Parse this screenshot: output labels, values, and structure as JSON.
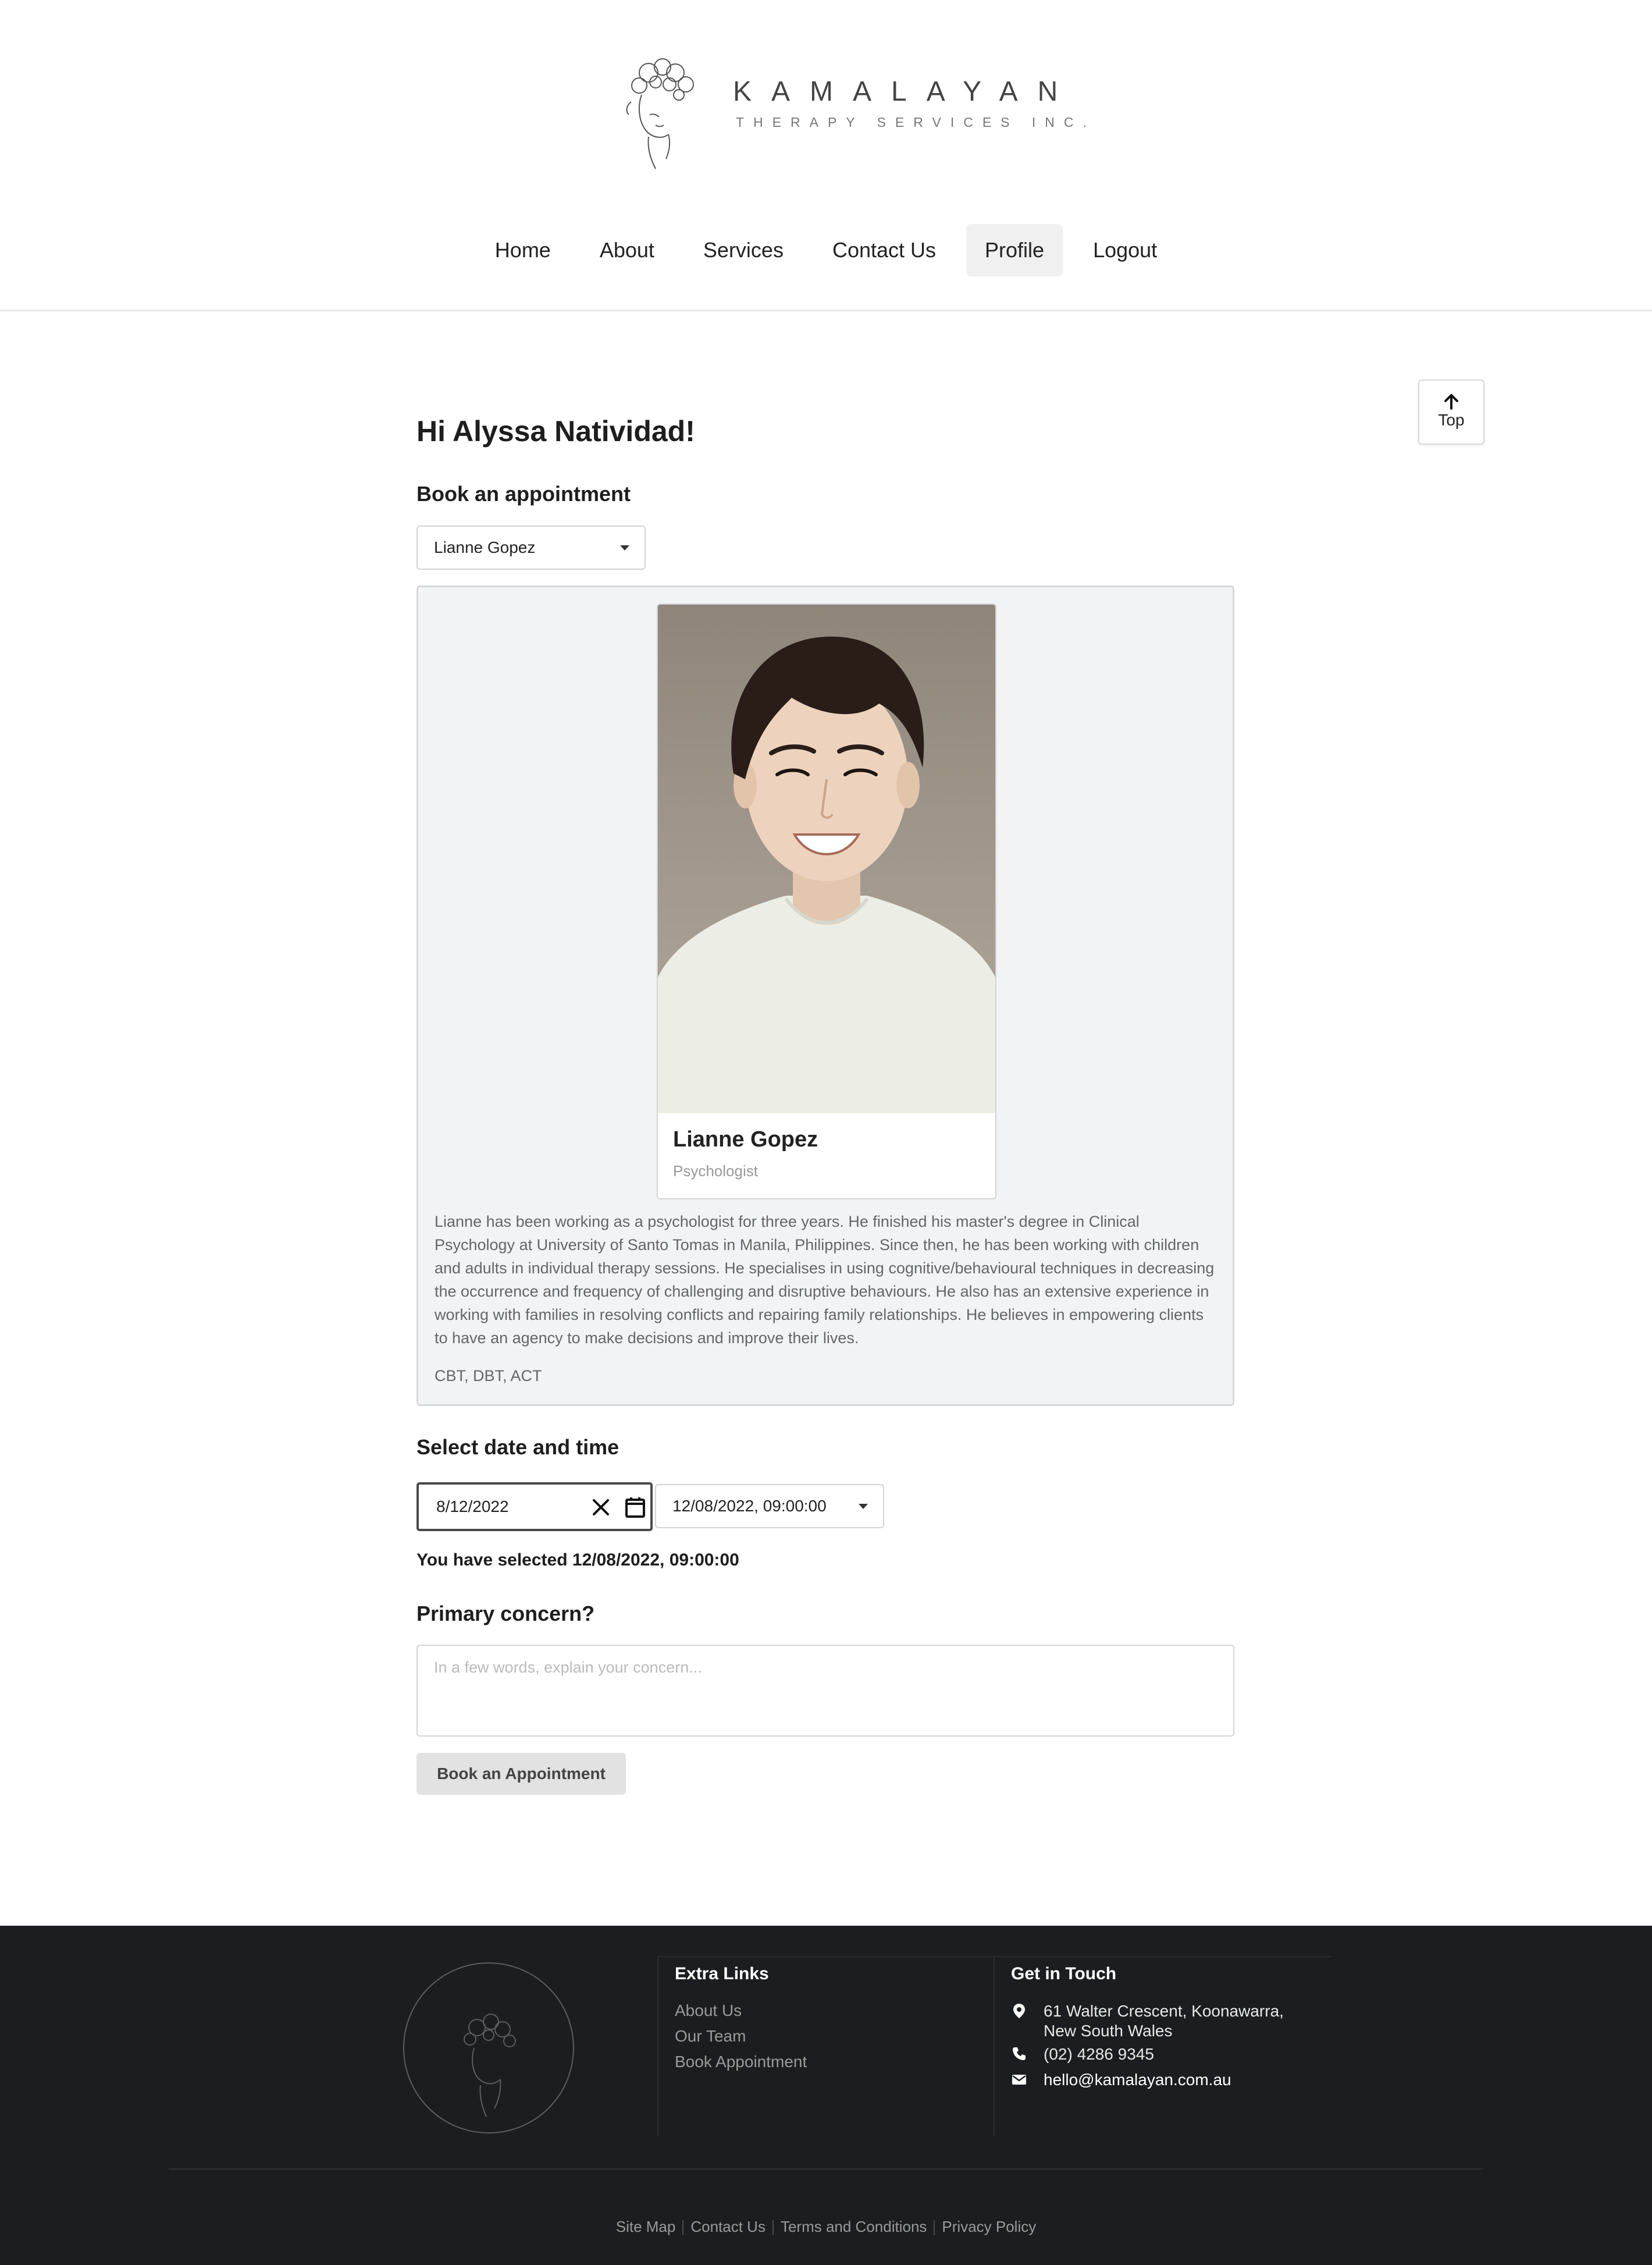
{
  "brand": {
    "title": "KAMALAYAN",
    "subtitle": "THERAPY SERVICES INC."
  },
  "nav": {
    "items": [
      "Home",
      "About",
      "Services",
      "Contact Us",
      "Profile",
      "Logout"
    ],
    "active": "Profile"
  },
  "top_button": {
    "label": "Top"
  },
  "main": {
    "greeting": "Hi Alyssa Natividad!",
    "book_heading": "Book an appointment",
    "therapist_select": {
      "value": "Lianne Gopez"
    },
    "therapist": {
      "name": "Lianne Gopez",
      "role": "Psychologist",
      "bio": "Lianne has been working as a psychologist for three years. He finished his master's degree in Clinical Psychology at University of Santo Tomas in Manila, Philippines. Since then, he has been working with children and adults in individual therapy sessions. He specialises in using cognitive/behavioural techniques in decreasing the occurrence and frequency of challenging and disruptive behaviours. He also has an extensive experience in working with families in resolving conflicts and repairing family relationships. He believes in empowering clients to have an agency to make decisions and improve their lives.",
      "modalities": "CBT, DBT, ACT"
    },
    "date_heading": "Select date and time",
    "date_value": "8/12/2022",
    "time_select": {
      "value": "12/08/2022, 09:00:00"
    },
    "selected_text": "You have selected 12/08/2022, 09:00:00",
    "concern_heading": "Primary concern?",
    "concern_placeholder": "In a few words, explain your concern...",
    "book_button": "Book an Appointment"
  },
  "footer": {
    "extra_links_title": "Extra Links",
    "extra_links": [
      "About Us",
      "Our Team",
      "Book Appointment"
    ],
    "contact_title": "Get in Touch",
    "address_line1": "61 Walter Crescent, Koonawarra,",
    "address_line2": "New South Wales",
    "phone": "(02) 4286 9345",
    "email": "hello@kamalayan.com.au",
    "bottom_links": [
      "Site Map",
      "Contact Us",
      "Terms and Conditions",
      "Privacy Policy"
    ]
  },
  "icons": {
    "top_button": "arrow-up-icon",
    "date_clear": "close-icon",
    "date_picker": "calendar-icon",
    "address": "map-pin-icon",
    "phone": "phone-icon",
    "email": "envelope-icon"
  }
}
